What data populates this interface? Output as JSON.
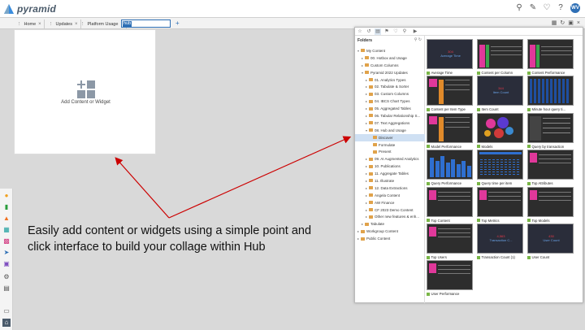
{
  "app": {
    "name": "pyramid"
  },
  "topbar": {
    "icons": [
      "search-icon",
      "pin-icon",
      "bell-icon",
      "help-icon"
    ],
    "avatar_initials": "WV"
  },
  "tabs": [
    {
      "label": "Home"
    },
    {
      "label": "Updates"
    },
    {
      "label": "Platform Usage"
    }
  ],
  "tab_edit": {
    "value": "hub"
  },
  "tab_add": "+",
  "canvas": {
    "add_label": "Add Content or Widget"
  },
  "caption": "Easily add content or widgets using a simple point and click interface to build your collage within Hub",
  "folders": {
    "title": "Folders",
    "tree": [
      {
        "label": "My Content",
        "level": 0,
        "expanded": true
      },
      {
        "label": "00. Hotbox and Usage",
        "level": 1,
        "expanded": false
      },
      {
        "label": "Custom Columns",
        "level": 1,
        "expanded": false
      },
      {
        "label": "Pyramid 2022 Updates",
        "level": 1,
        "expanded": true
      },
      {
        "label": "01. Analytics Types",
        "level": 2,
        "expanded": false
      },
      {
        "label": "02. Tabulate & Sorter",
        "level": 2,
        "expanded": false
      },
      {
        "label": "03. Custom Columns",
        "level": 2,
        "expanded": false
      },
      {
        "label": "04. IBCS Chart Types",
        "level": 2,
        "expanded": false
      },
      {
        "label": "05. Aggregated Tables",
        "level": 2,
        "expanded": false
      },
      {
        "label": "06. Tabular Relationship S...",
        "level": 2,
        "expanded": false
      },
      {
        "label": "07. Text Aggregations",
        "level": 2,
        "expanded": false
      },
      {
        "label": "08. Hub and Usage",
        "level": 2,
        "expanded": true
      },
      {
        "label": "Discover",
        "level": 3,
        "selected": true
      },
      {
        "label": "Formulate",
        "level": 3
      },
      {
        "label": "Present",
        "level": 3
      },
      {
        "label": "09. AI Augmented Analytics",
        "level": 2,
        "expanded": false
      },
      {
        "label": "10. Publications",
        "level": 2,
        "expanded": false
      },
      {
        "label": "11. Aggregate Tables",
        "level": 2,
        "expanded": false
      },
      {
        "label": "11. Illustrate",
        "level": 2,
        "expanded": false
      },
      {
        "label": "12. Data Extractions",
        "level": 2,
        "expanded": false
      },
      {
        "label": "Angela Content",
        "level": 2,
        "expanded": false
      },
      {
        "label": "AW Finance",
        "level": 2,
        "expanded": false
      },
      {
        "label": "CF 2023 Demo Content",
        "level": 2,
        "expanded": false
      },
      {
        "label": "Other new features & enh...",
        "level": 2,
        "expanded": false
      },
      {
        "label": "Tabulate",
        "level": 1,
        "expanded": false
      },
      {
        "label": "Workgroup Content",
        "level": 0,
        "expanded": false
      },
      {
        "label": "Public Content",
        "level": 0,
        "expanded": false
      }
    ]
  },
  "tiles": [
    {
      "label": "Average Time",
      "thumb": "kpi",
      "kpi_value": "304",
      "kpi_sub": "Average Time"
    },
    {
      "label": "Content per Column",
      "thumb": "bar-magenta"
    },
    {
      "label": "Content Performance",
      "thumb": "bar-magenta"
    },
    {
      "label": "Content per Item Type",
      "thumb": "table-orange"
    },
    {
      "label": "Item Count",
      "thumb": "kpi",
      "kpi_value": "344",
      "kpi_sub": "Item Count"
    },
    {
      "label": "Minute hour query ti...",
      "thumb": "heatmap-blue"
    },
    {
      "label": "Model Performance",
      "thumb": "table-orange"
    },
    {
      "label": "Models",
      "thumb": "bubbles"
    },
    {
      "label": "Query by transaction",
      "thumb": "table-dark"
    },
    {
      "label": "Query Performance",
      "thumb": "bars-blue"
    },
    {
      "label": "Query time per item",
      "thumb": "bars-blue-small"
    },
    {
      "label": "Top Attributes",
      "thumb": "table-magenta"
    },
    {
      "label": "Top Content",
      "thumb": "table-magenta"
    },
    {
      "label": "Top Metrics",
      "thumb": "table-magenta"
    },
    {
      "label": "Top Models",
      "thumb": "table-magenta"
    },
    {
      "label": "Top Users",
      "thumb": "table-magenta"
    },
    {
      "label": "Transaction Count (1)",
      "thumb": "kpi",
      "kpi_value": "4,563",
      "kpi_sub": "Transaction C..."
    },
    {
      "label": "User Count",
      "thumb": "kpi",
      "kpi_value": "430",
      "kpi_sub": "User Count"
    },
    {
      "label": "User Performance",
      "thumb": "table-magenta"
    }
  ],
  "rail": {
    "icons": [
      "hub-icon",
      "chart-icon",
      "formulate-icon",
      "grid-icon",
      "dashboard-icon",
      "send-icon",
      "image-icon",
      "gear-icon",
      "folder-icon",
      "monitor-icon",
      "home-icon"
    ]
  },
  "colors": {
    "accent": "#2e6fb5",
    "annotation": "#cc0000",
    "thumb_bg": "#2d2d2d",
    "magenta": "#e0389a",
    "folder": "#e0a24a"
  }
}
